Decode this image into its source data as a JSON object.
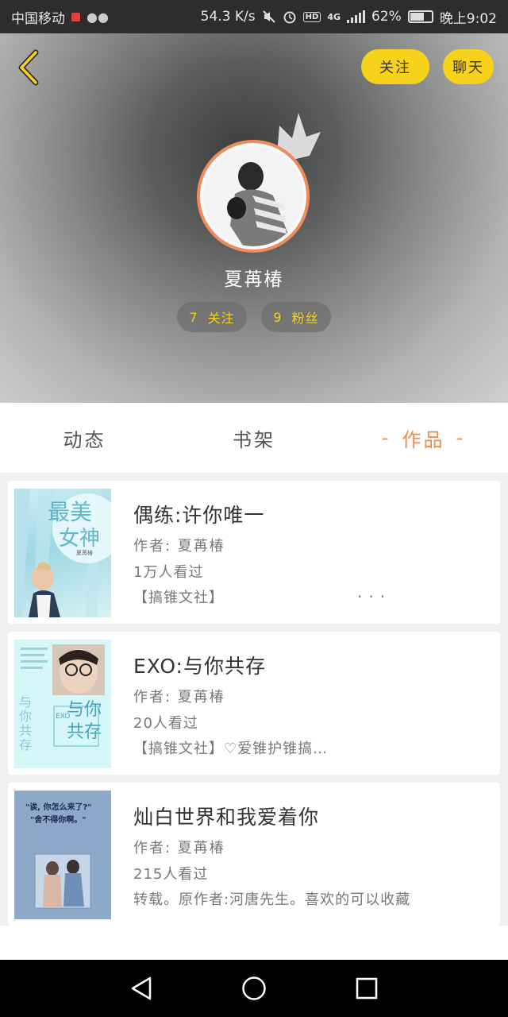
{
  "status_bar": {
    "carrier": "中国移动",
    "net_speed": "54.3 K/s",
    "network": "4G",
    "battery": "62%",
    "battery_level": 0.62,
    "time": "晚上9:02"
  },
  "header": {
    "follow_label": "关注",
    "chat_label": "聊天",
    "username": "夏苒椿",
    "following_count": "7",
    "following_label": "关注",
    "fans_count": "9",
    "fans_label": "粉丝"
  },
  "tabs": [
    {
      "label": "动态",
      "active": false
    },
    {
      "label": "书架",
      "active": false
    },
    {
      "label": "作品",
      "active": true,
      "dash": "-"
    }
  ],
  "works": [
    {
      "title": "偶练:许你唯一",
      "author": "作者: 夏苒椿",
      "views": "1万人看过",
      "desc": "【搞锥文社】",
      "more": "...",
      "cover_text": [
        "最美",
        "女神",
        "夏苒椿"
      ]
    },
    {
      "title": "EXO:与你共存",
      "author": "作者: 夏苒椿",
      "views": "20人看过",
      "desc": "【搞锥文社】♡爱锥护锥搞…",
      "cover_text": [
        "与你",
        "共存",
        "EXO",
        "与你共存"
      ]
    },
    {
      "title": "灿白世界和我爱着你",
      "author": "作者: 夏苒椿",
      "views": "215人看过",
      "desc": "转载。原作者:河唐先生。喜欢的可以收藏",
      "cover_text": [
        "\"诶, 你怎么来了?\"",
        "\"舍不得你啊。\""
      ]
    }
  ],
  "colors": {
    "accent_yellow": "#f7d21a",
    "accent_orange": "#ef8b4c",
    "status_bar_bg": "#2d2d2d",
    "nav_bar_bg": "#000000"
  }
}
